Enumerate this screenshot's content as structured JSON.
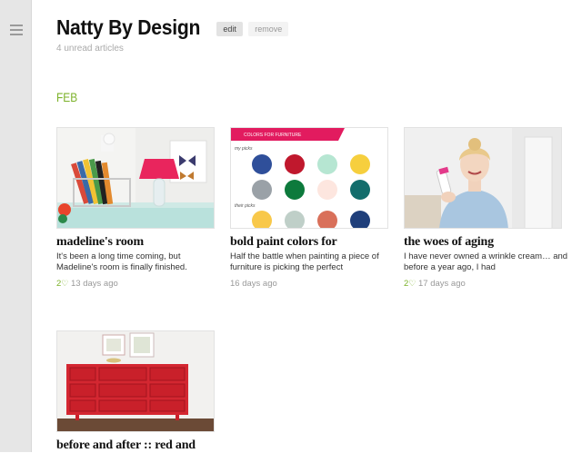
{
  "blog": {
    "title": "Natty By Design",
    "edit_label": "edit",
    "remove_label": "remove",
    "unread": "4 unread articles"
  },
  "month": "FEB",
  "articles": [
    {
      "title": "madeline's room",
      "excerpt": "It's been a long time coming, but Madeline's room is finally finished.",
      "likes": "2",
      "age": "13 days ago",
      "image": "kids-room-desk-photo"
    },
    {
      "title": "bold paint colors for",
      "excerpt": "Half the battle when painting a piece of furniture is picking the perfect",
      "likes": "",
      "age": "16 days ago",
      "image": "paint-color-swatches",
      "image_text": {
        "banner": "COLORS FOR FURNITURE",
        "my_picks": "my picks",
        "their_picks": "their picks"
      },
      "swatches": [
        "#2f4f9a",
        "#c0182d",
        "#b6e6d2",
        "#f6cf3e",
        "#9aa1a7",
        "#0d7a3c",
        "#fde6df",
        "#136d6c",
        "#f8c84a",
        "#bfcfc8",
        "#d9705a",
        "#1f3f7a"
      ]
    },
    {
      "title": "the woes of aging",
      "excerpt": "I have never owned a wrinkle cream… and before a year ago, I had",
      "likes": "2",
      "age": "17 days ago",
      "image": "woman-portrait-photo"
    },
    {
      "title": "before and after :: red and",
      "excerpt": "",
      "likes": "",
      "age": "",
      "image": "red-dresser-photo"
    }
  ]
}
